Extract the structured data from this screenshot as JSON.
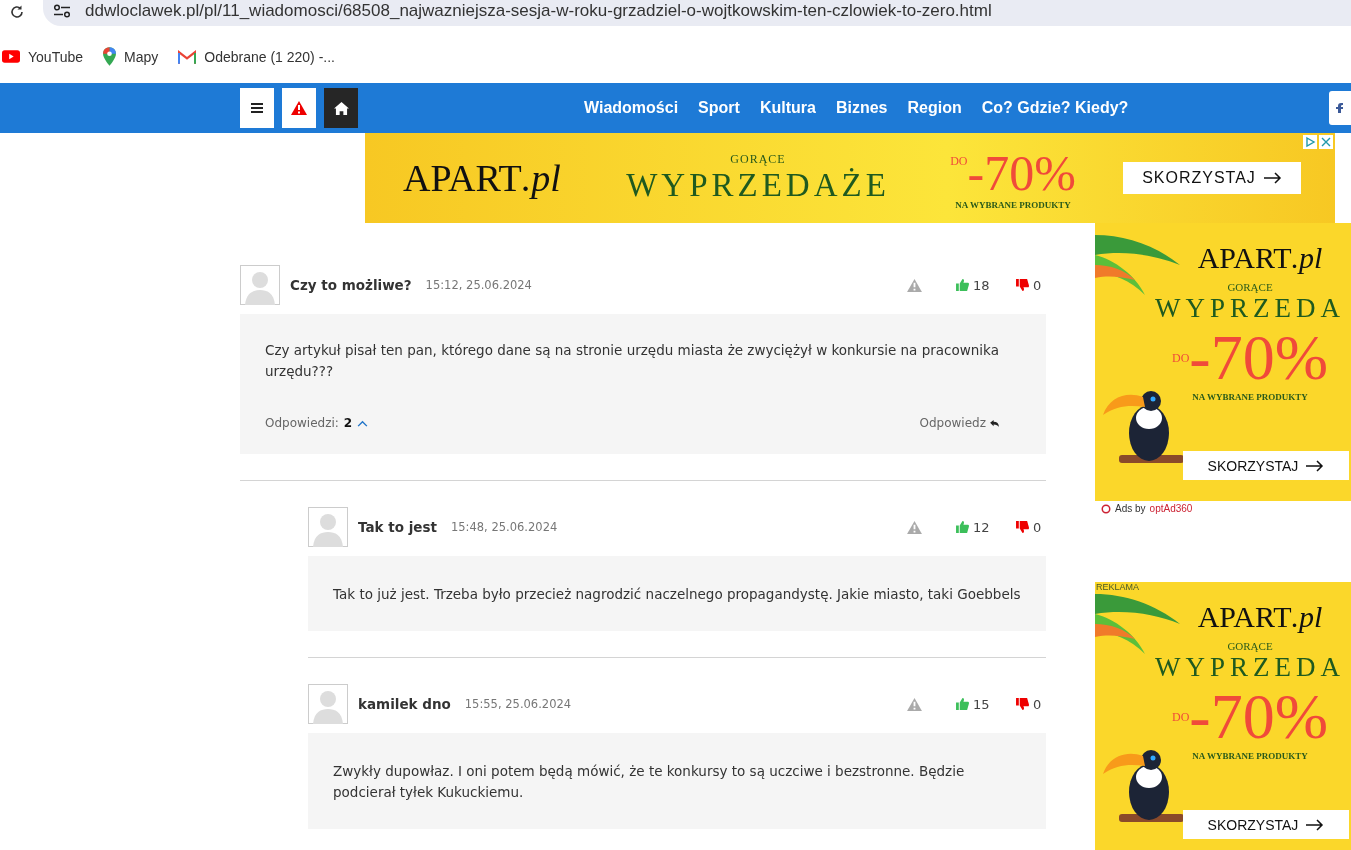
{
  "browser": {
    "address": "ddwloclawek.pl/pl/11_wiadomosci/68508_najwazniejsza-sesja-w-roku-grzadziel-o-wojtkowskim-ten-czlowiek-to-zero.html",
    "bookmarks": [
      {
        "label": "YouTube",
        "kind": "youtube"
      },
      {
        "label": "Mapy",
        "kind": "maps"
      },
      {
        "label": "Odebrane (1 220) -...",
        "kind": "gmail"
      }
    ]
  },
  "nav": {
    "items": [
      "Wiadomości",
      "Sport",
      "Kultura",
      "Biznes",
      "Region",
      "Co? Gdzie? Kiedy?"
    ]
  },
  "top_ad": {
    "brand": "APART",
    "brand_suffix": ".pl",
    "kicker": "GORĄCE",
    "headline": "WYPRZEDAŻE",
    "prefix": "DO",
    "discount": "-70%",
    "note": "NA WYBRANE PRODUKTY",
    "cta": "SKORZYSTAJ"
  },
  "sidebar_ads": [
    {
      "brand": "APART",
      "brand_suffix": ".pl",
      "kicker": "GORĄCE",
      "headline": "WYPRZEDA",
      "prefix": "DO",
      "discount": "-70%",
      "note": "NA WYBRANE PRODUKTY",
      "cta": "SKORZYSTAJ",
      "credit": "Ads by",
      "credit_brand": "optAd360"
    },
    {
      "label": "REKLAMA",
      "brand": "APART",
      "brand_suffix": ".pl",
      "kicker": "GORĄCE",
      "headline": "WYPRZEDA",
      "prefix": "DO",
      "discount": "-70%",
      "note": "NA WYBRANE PRODUKTY",
      "cta": "SKORZYSTAJ"
    }
  ],
  "comments": [
    {
      "author": "Czy to możliwe?",
      "time": "15:12, 25.06.2024",
      "likes": "18",
      "dislikes": "0",
      "text": "Czy artykuł pisał ten pan, którego dane są na stronie urzędu miasta że zwyciężył w konkursie na pracownika urzędu???",
      "replies_label": "Odpowiedzi:",
      "replies_count": "2",
      "expanded": true,
      "reply_label": "Odpowiedz",
      "children": [
        {
          "author": "Tak to jest",
          "time": "15:48, 25.06.2024",
          "likes": "12",
          "dislikes": "0",
          "text": "Tak to już jest. Trzeba było przecież nagrodzić naczelnego propagandystę. Jakie miasto, taki Goebbels"
        },
        {
          "author": "kamilek dno",
          "time": "15:55, 25.06.2024",
          "likes": "15",
          "dislikes": "0",
          "text": "Zwykły dupowłaz. I oni potem będą mówić, że te konkursy to są uczciwe i bezstronne. Będzie podcierał tyłek Kukuckiemu."
        }
      ]
    }
  ]
}
